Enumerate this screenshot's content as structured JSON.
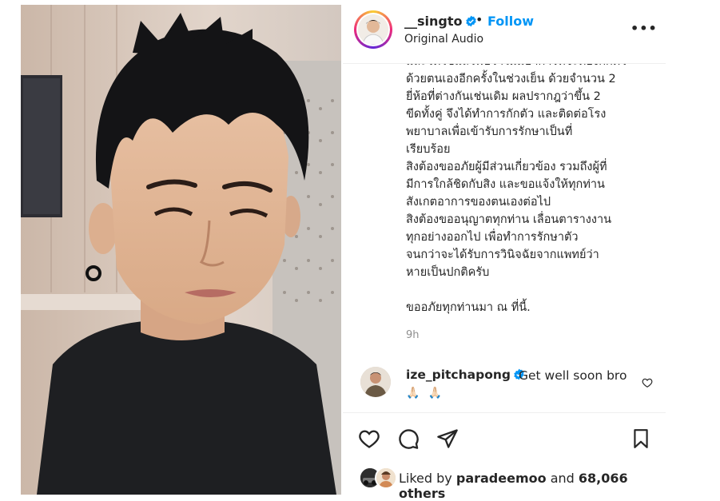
{
  "post": {
    "username": "__singto",
    "dot": "•",
    "follow_label": "Follow",
    "audio_label": "Original Audio",
    "more_label": "•••"
  },
  "caption_lines": [
    "และวัดไข้แล้วพบว่าไม่มีอาการที่จะต้องกักตัว",
    "ด้วยตนเองอีกครั้งในช่วงเย็น ด้วยจำนวน 2",
    "ยี่ห้อที่ต่างกันเช่นเดิม ผลปรากฎว่าขึ้น 2",
    "ขีดทั้งคู่ จึงได้ทำการกักตัว และติดต่อโรง",
    "พยาบาลเพื่อเข้ารับการรักษาเป็นที่",
    "เรียบร้อย",
    "สิงต้องขออภัยผู้มีส่วนเกี่ยวข้อง รวมถึงผู้ที่",
    "มีการใกล้ชิดกับสิง และขอแจ้งให้ทุกท่าน",
    "สังเกตอาการของตนเองต่อไป",
    "สิงต้องขออนุญาตทุกท่าน เลื่อนตารางงาน",
    "ทุกอย่างออกไป เพื่อทำการรักษาตัว",
    "จนกว่าจะได้รับการวินิจฉัยจากแพทย์ว่า",
    "หายเป็นปกติครับ",
    "",
    "ขออภัยทุกท่านมา ณ ที่นี้."
  ],
  "timestamp": "9h",
  "comment": {
    "username": "ize_pitchapong",
    "text": "Get well soon bro",
    "emoji": "🙏🏻 🙏🏻"
  },
  "likes": {
    "prefix": "Liked by",
    "user": "paradeemoo",
    "and": "and",
    "count": "68,066 others"
  },
  "icons": [
    "heart-icon",
    "comment-icon",
    "share-icon",
    "bookmark-icon",
    "verified-badge-icon",
    "more-options-icon"
  ],
  "colors": {
    "accent": "#0095f6",
    "text": "#262626",
    "muted": "#8e8e8e",
    "border": "#efefef"
  }
}
